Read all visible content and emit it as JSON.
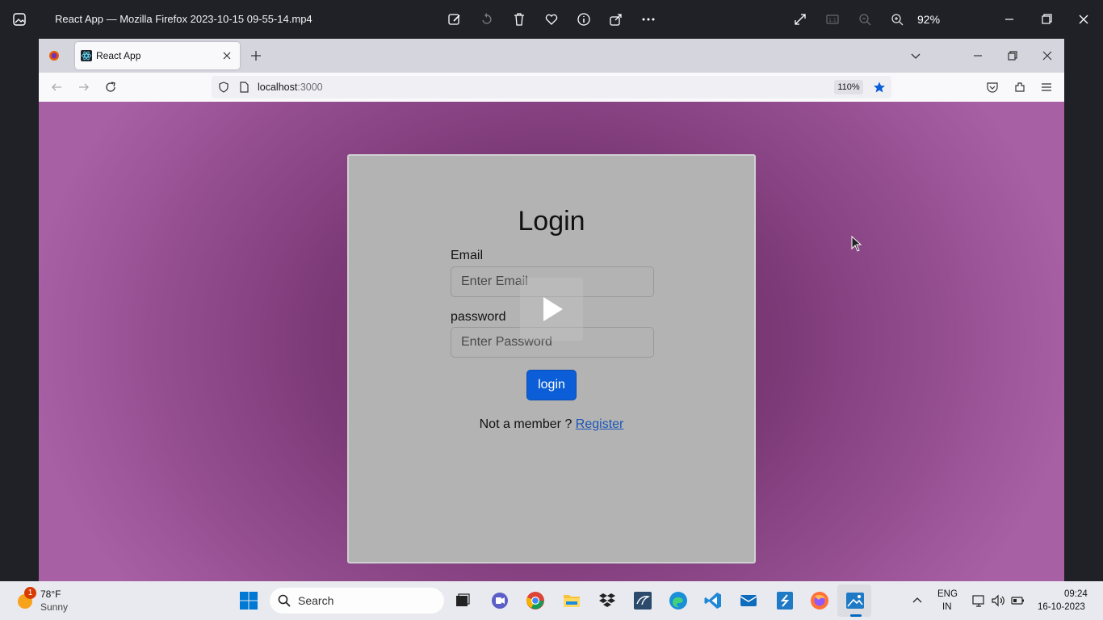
{
  "photos_app": {
    "title": "React App — Mozilla Firefox 2023-10-15 09-55-14.mp4",
    "zoom": "92%",
    "zoom_reset": "1:1"
  },
  "firefox": {
    "tab_title": "React App",
    "url_host": "localhost",
    "url_port": ":3000",
    "page_zoom": "110%"
  },
  "page": {
    "heading": "Login",
    "email_label": "Email",
    "email_placeholder": "Enter Email",
    "password_label": "password",
    "password_placeholder": "Enter Password",
    "login_button": "login",
    "member_text": "Not a member ? ",
    "register_link": "Register"
  },
  "taskbar": {
    "weather_temp": "78°F",
    "weather_desc": "Sunny",
    "weather_badge": "1",
    "search_label": "Search",
    "lang_line1": "ENG",
    "lang_line2": "IN",
    "time": "09:24",
    "date": "16-10-2023"
  },
  "colors": {
    "accent_button": "#0b5ed7",
    "page_bg_dark": "#5e2358",
    "page_bg_light": "#a860a5",
    "card_bg": "#b3b3b3"
  }
}
